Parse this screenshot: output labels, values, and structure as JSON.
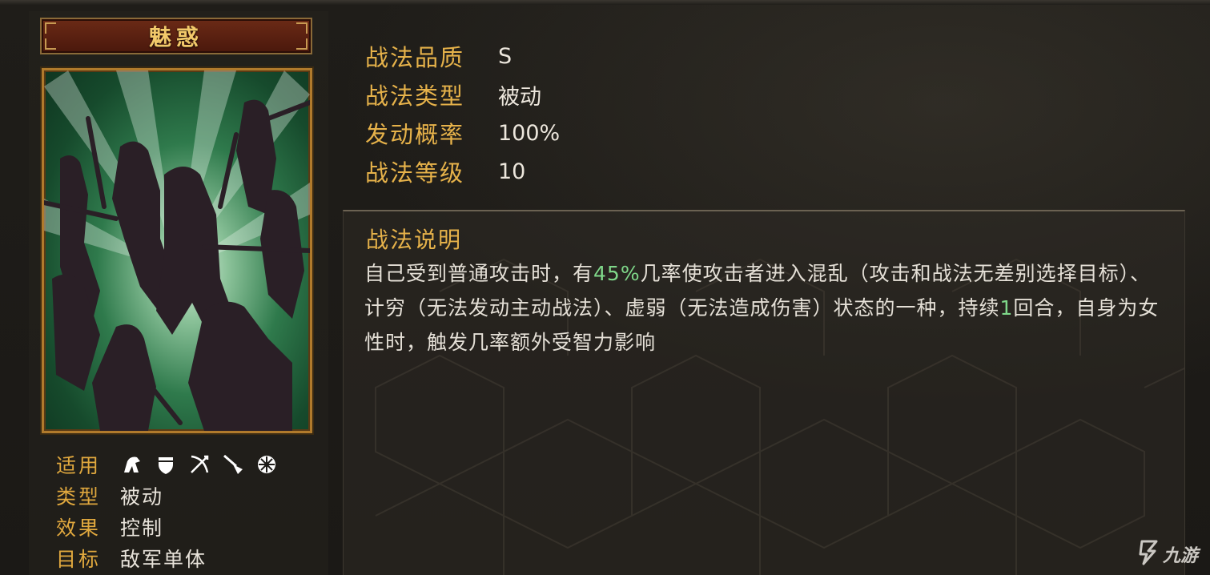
{
  "skill": {
    "name": "魅惑"
  },
  "meta": {
    "applicable_label": "适用",
    "troop_icons": [
      "cavalry-icon",
      "shield-icon",
      "archer-icon",
      "spear-icon",
      "siege-icon"
    ],
    "type_label": "类型",
    "type_value": "被动",
    "effect_label": "效果",
    "effect_value": "控制",
    "target_label": "目标",
    "target_value": "敌军单体"
  },
  "attributes": [
    {
      "label": "战法品质",
      "value": "S"
    },
    {
      "label": "战法类型",
      "value": "被动"
    },
    {
      "label": "发动概率",
      "value": "100%"
    },
    {
      "label": "战法等级",
      "value": "10"
    }
  ],
  "description": {
    "title": "战法说明",
    "part1": "自己受到普通攻击时，有",
    "highlight1": "45%",
    "part2": "几率使攻击者进入混乱（攻击和战法无差别选择目标）、计穷（无法发动主动战法）、虚弱（无法造成伤害）状态的一种，持续",
    "highlight2": "1",
    "part3": "回合，自身为女性时，触发几率额外受智力影响"
  },
  "watermark": {
    "text": "九游",
    "icon": "jiuyou-logo-icon"
  },
  "colors": {
    "label_gold": "#e6b24a",
    "highlight_green": "#7fd88a",
    "banner_red": "#6b2a16",
    "frame_gold": "#b07a2c"
  }
}
